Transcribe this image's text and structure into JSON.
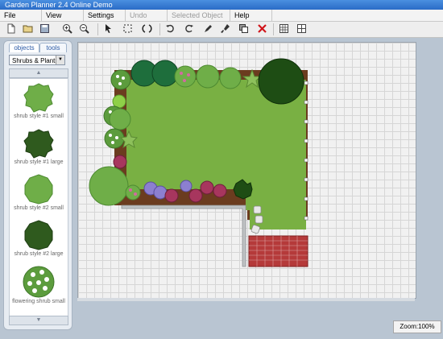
{
  "window": {
    "title": "Garden Planner 2.4 Online Demo"
  },
  "menu": [
    {
      "label": "File",
      "enabled": true
    },
    {
      "label": "View",
      "enabled": true
    },
    {
      "label": "Settings",
      "enabled": true
    },
    {
      "label": "Undo",
      "enabled": false
    },
    {
      "label": "Selected Object",
      "enabled": false
    },
    {
      "label": "Help",
      "enabled": true
    }
  ],
  "toolbar": {
    "tools": [
      "new-icon",
      "open-icon",
      "save-icon",
      "zoom-in-icon",
      "zoom-out-icon",
      "select-icon",
      "marquee-icon",
      "rotate-icon",
      "rotate-left-icon",
      "rotate-right-icon",
      "pen-icon",
      "brush-icon",
      "copy-icon",
      "delete-icon",
      "grid-icon",
      "snap-icon"
    ]
  },
  "sidebar": {
    "tabs": [
      {
        "label": "objects",
        "active": true
      },
      {
        "label": "tools",
        "active": false
      }
    ],
    "category": "Shrubs & Plants",
    "items": [
      {
        "label": "shrub style #1 small",
        "color": "#6fae48"
      },
      {
        "label": "shrub style #1 large",
        "color": "#2f5a1e"
      },
      {
        "label": "shrub style #2 small",
        "color": "#6fae48"
      },
      {
        "label": "shrub style #2 large",
        "color": "#2f5a1e"
      },
      {
        "label": "flowering shrub small",
        "color": "#6fae48"
      }
    ]
  },
  "canvas": {
    "colors": {
      "lawn": "#79b043",
      "soil": "#6b3c1f",
      "patio": "#b53a3a",
      "paving": "#bfc2c4",
      "shrub_light": "#6fae48",
      "shrub_dark": "#2f5a1e",
      "flower_pink": "#d26aa0",
      "flower_purple": "#8c7fd0"
    }
  },
  "status": {
    "zoom": "Zoom:100%"
  }
}
